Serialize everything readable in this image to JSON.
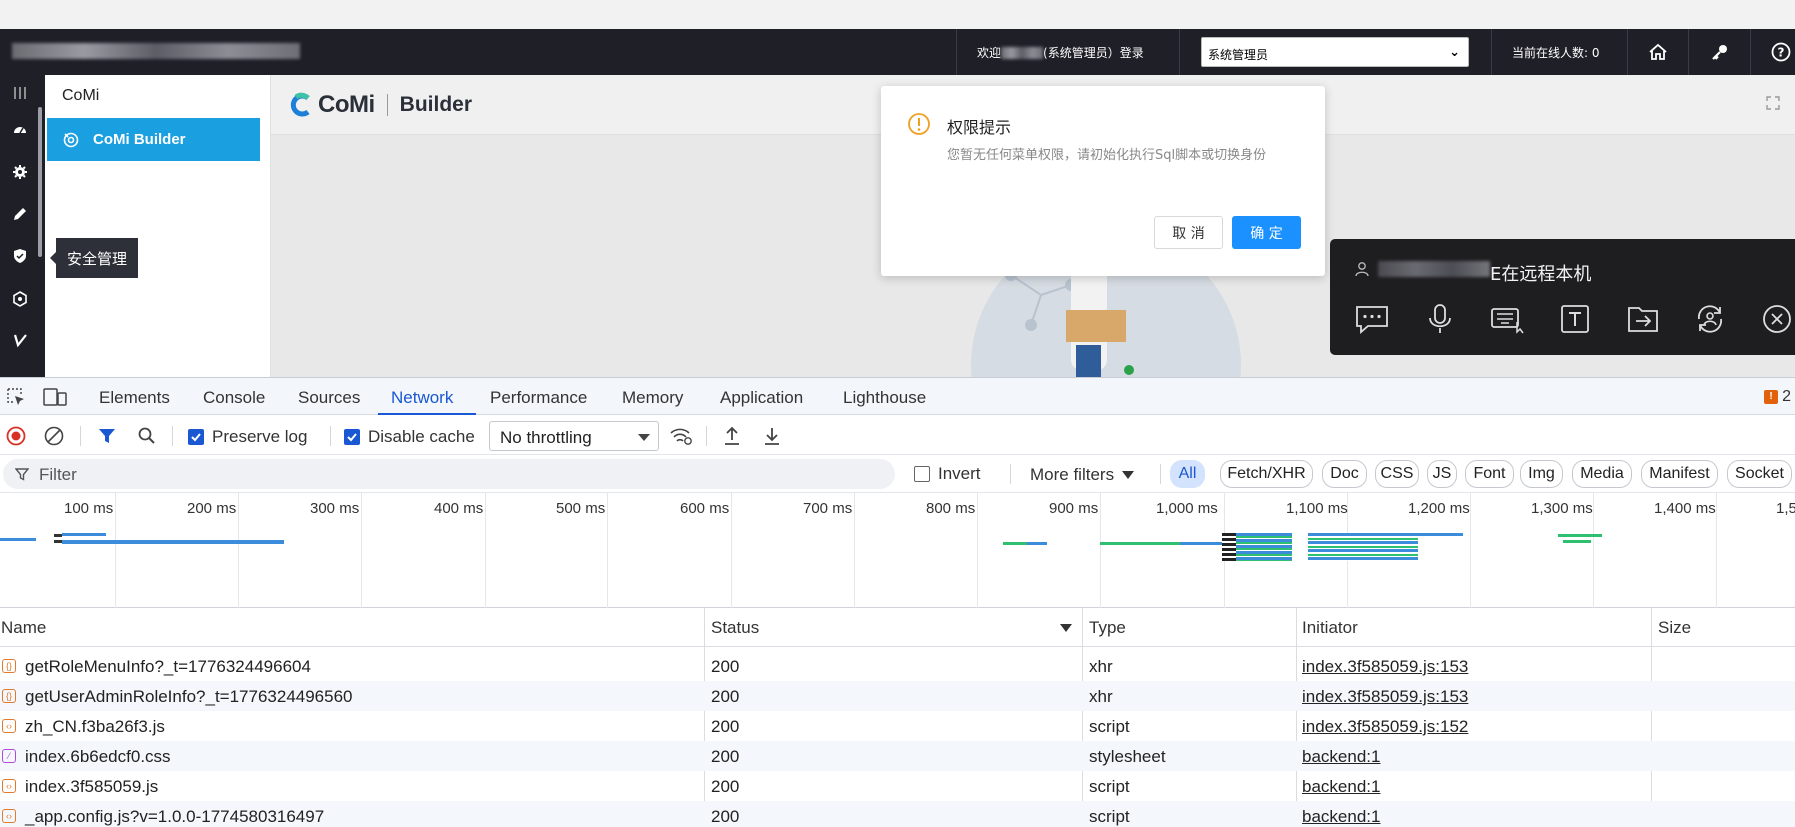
{
  "app": {
    "header": {
      "welcome_prefix": "欢迎",
      "welcome_suffix": "(系统管理员）登录",
      "role_selected": "系统管理员",
      "online_label": "当前在线人数: 0"
    },
    "menu": {
      "title": "CoMi",
      "items": [
        {
          "label": "CoMi Builder",
          "icon": "comi-builder-icon"
        }
      ]
    },
    "iconbar": [
      "menu-icon",
      "dashboard-icon",
      "settings-icon",
      "edit-icon",
      "shield-icon",
      "network-icon",
      "pen-icon"
    ],
    "tooltip": "安全管理",
    "logo": {
      "brand": "CoMi",
      "product": "Builder"
    }
  },
  "dialog": {
    "title": "权限提示",
    "message": "您暂无任何菜单权限，请初始化执行Sql脚本或切换身份",
    "cancel": "取 消",
    "ok": "确 定"
  },
  "remote": {
    "text": "E在远程本机",
    "tools": [
      "chat-icon",
      "microphone-icon",
      "keyboard-icon",
      "text-icon",
      "transfer-icon",
      "switch-icon",
      "close-icon"
    ]
  },
  "devtools": {
    "tabs": [
      "Elements",
      "Console",
      "Sources",
      "Network",
      "Performance",
      "Memory",
      "Application",
      "Lighthouse"
    ],
    "active_tab": "Network",
    "issues_count": "2",
    "toolbar": {
      "preserve_log": "Preserve log",
      "disable_cache": "Disable cache",
      "throttling": "No throttling"
    },
    "filter": {
      "placeholder": "Filter",
      "invert": "Invert",
      "more_filters": "More filters",
      "types": [
        "All",
        "Fetch/XHR",
        "Doc",
        "CSS",
        "JS",
        "Font",
        "Img",
        "Media",
        "Manifest",
        "Socket"
      ]
    },
    "timeline_ticks": [
      "100 ms",
      "200 ms",
      "300 ms",
      "400 ms",
      "500 ms",
      "600 ms",
      "700 ms",
      "800 ms",
      "900 ms",
      "1,000 ms",
      "1,100 ms",
      "1,200 ms",
      "1,300 ms",
      "1,400 ms",
      "1,5"
    ],
    "columns": [
      "Name",
      "Status",
      "Type",
      "Initiator",
      "Size"
    ],
    "rows": [
      {
        "name": "getRoleMenuInfo?_t=1776324496604",
        "status": "200",
        "type": "xhr",
        "initiator": "index.3f585059.js:153",
        "kind": "xhr"
      },
      {
        "name": "getUserAdminRoleInfo?_t=1776324496560",
        "status": "200",
        "type": "xhr",
        "initiator": "index.3f585059.js:153",
        "kind": "xhr"
      },
      {
        "name": "zh_CN.f3ba26f3.js",
        "status": "200",
        "type": "script",
        "initiator": "index.3f585059.js:152",
        "kind": "script"
      },
      {
        "name": "index.6b6edcf0.css",
        "status": "200",
        "type": "stylesheet",
        "initiator": "backend:1",
        "kind": "css"
      },
      {
        "name": "index.3f585059.js",
        "status": "200",
        "type": "script",
        "initiator": "backend:1",
        "kind": "script"
      },
      {
        "name": "_app.config.js?v=1.0.0-1774580316497",
        "status": "200",
        "type": "script",
        "initiator": "backend:1",
        "kind": "script"
      }
    ]
  },
  "colors": {
    "accent": "#1a9fe0",
    "devtools_blue": "#1a57d2",
    "header_bg": "#1f1f28",
    "ok_button": "#1a91ff"
  }
}
